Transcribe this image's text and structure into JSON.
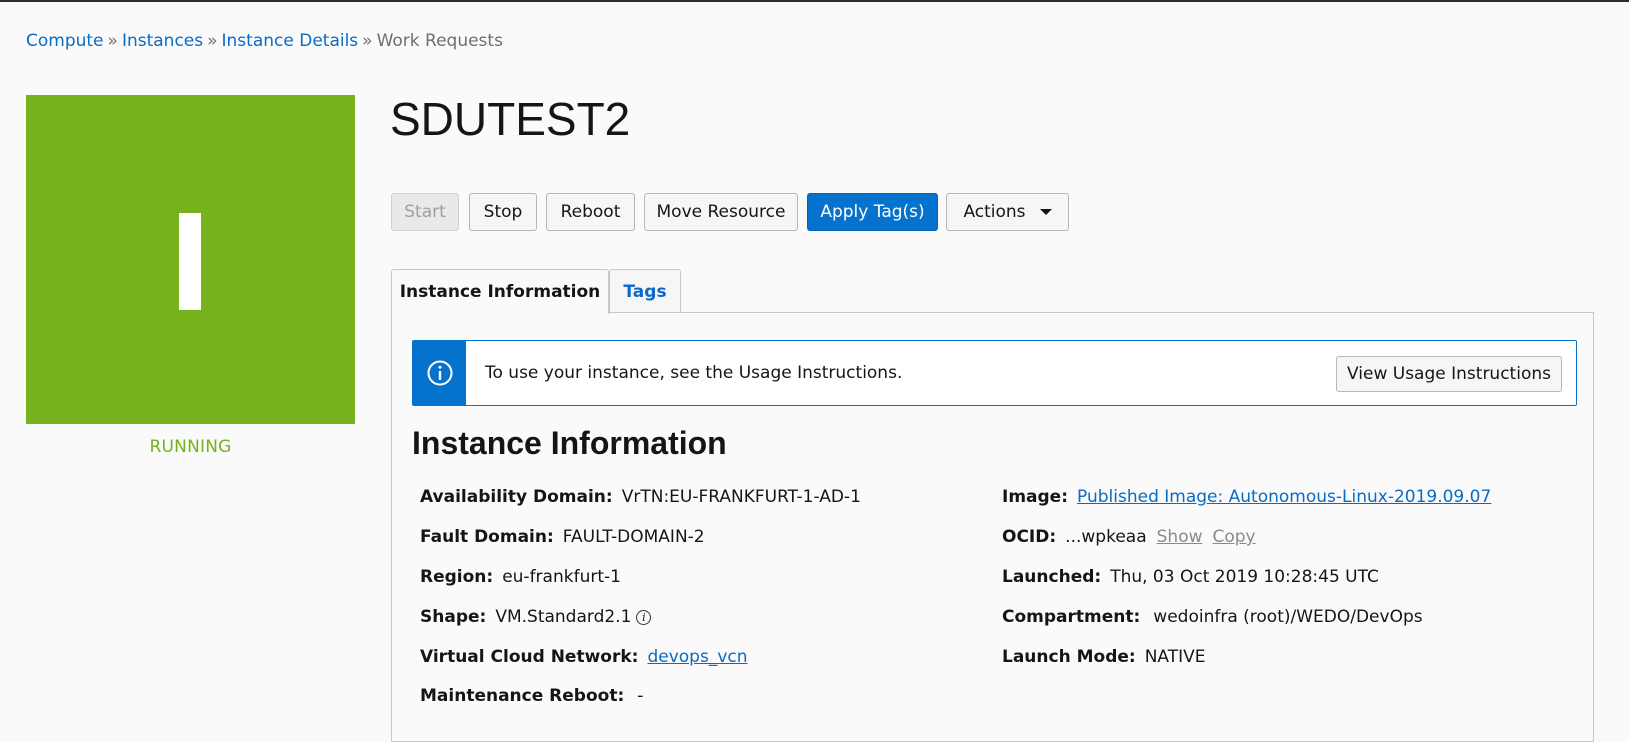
{
  "breadcrumb": {
    "items": [
      "Compute",
      "Instances",
      "Instance Details"
    ],
    "separator": "»",
    "current": "Work Requests"
  },
  "instance": {
    "name": "SDUTEST2",
    "status": "RUNNING",
    "status_letter": "I",
    "status_color": "#76b21b"
  },
  "toolbar": {
    "start": "Start",
    "stop": "Stop",
    "reboot": "Reboot",
    "move": "Move Resource",
    "apply_tags": "Apply Tag(s)",
    "actions": "Actions"
  },
  "tabs": {
    "info": "Instance Information",
    "tags": "Tags"
  },
  "notice": {
    "text": "To use your instance, see the Usage Instructions.",
    "button": "View Usage Instructions",
    "icon": "info-icon"
  },
  "details": {
    "title": "Instance Information",
    "availability_domain": {
      "label": "Availability Domain:",
      "value": "VrTN:EU-FRANKFURT-1-AD-1"
    },
    "fault_domain": {
      "label": "Fault Domain:",
      "value": "FAULT-DOMAIN-2"
    },
    "region": {
      "label": "Region:",
      "value": "eu-frankfurt-1"
    },
    "shape": {
      "label": "Shape:",
      "value": "VM.Standard2.1"
    },
    "vcn": {
      "label": "Virtual Cloud Network:",
      "value": "devops_vcn"
    },
    "maintenance_reboot": {
      "label": "Maintenance Reboot:",
      "value": "-"
    },
    "image": {
      "label": "Image:",
      "value": "Published Image: Autonomous-Linux-2019.09.07"
    },
    "ocid": {
      "label": "OCID:",
      "value": "...wpkeaa",
      "show": "Show",
      "copy": "Copy"
    },
    "launched": {
      "label": "Launched:",
      "value": "Thu, 03 Oct 2019 10:28:45 UTC"
    },
    "compartment": {
      "label": "Compartment:",
      "value": "wedoinfra (root)/WEDO/DevOps"
    },
    "launch_mode": {
      "label": "Launch Mode:",
      "value": "NATIVE"
    }
  }
}
